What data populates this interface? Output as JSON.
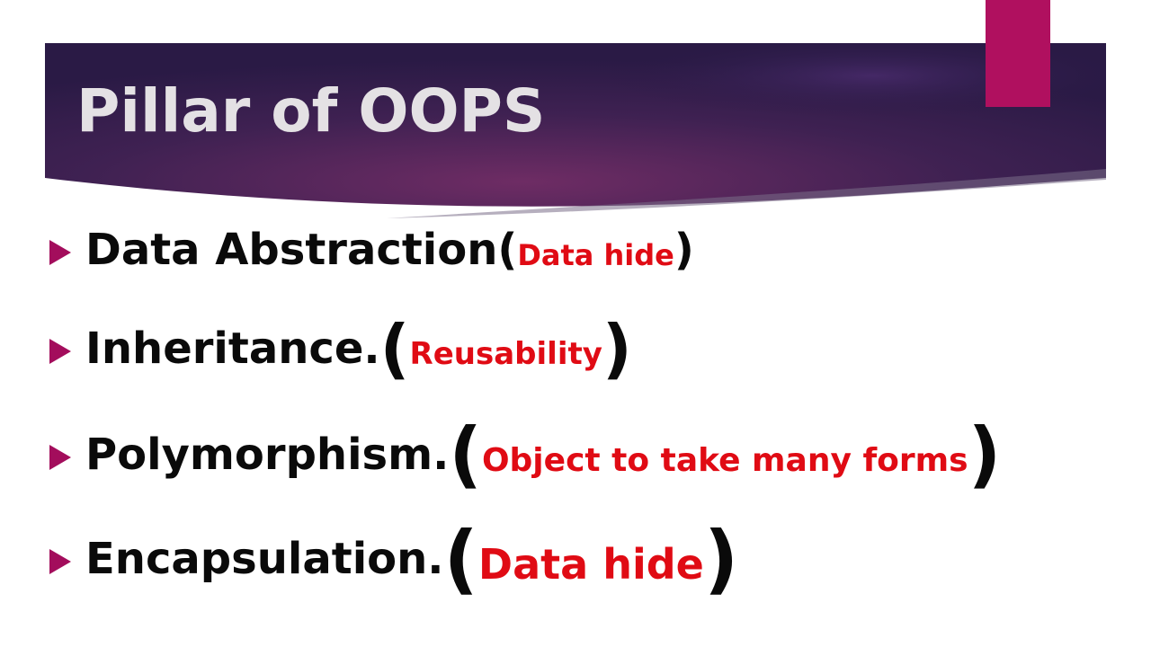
{
  "slide": {
    "title": "Pillar of OOPS",
    "colors": {
      "banner_dark": "#2a1a45",
      "banner_mid": "#5e2a60",
      "accent": "#b0105f",
      "bullet": "#a30d5c",
      "note": "#e00b14",
      "text": "#0a0a0a",
      "title_text": "#e4e1e4"
    },
    "bullets": [
      {
        "term": "Data Abstraction",
        "open": "(",
        "note": "Data hide",
        "close": ")"
      },
      {
        "term": "Inheritance. ",
        "open": "(",
        "note": "Reusability",
        "close": ")"
      },
      {
        "term": "Polymorphism. ",
        "open": "(",
        "note": "Object to take many forms",
        "close": ")"
      },
      {
        "term": "Encapsulation. ",
        "open": "(",
        "note": "Data hide",
        "close": ")"
      }
    ]
  }
}
